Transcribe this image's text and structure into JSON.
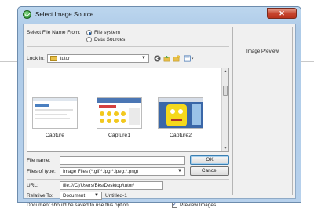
{
  "window": {
    "title": "Select Image Source",
    "close_glyph": "✕"
  },
  "select_from": {
    "label": "Select File Name From:",
    "options": [
      {
        "label": "File system",
        "selected": true
      },
      {
        "label": "Data Sources",
        "selected": false
      }
    ]
  },
  "look_in": {
    "label": "Look in:",
    "folder": "tutor",
    "toolbar_icons": [
      "back-arrow-icon",
      "up-folder-icon",
      "new-folder-icon",
      "view-menu-icon"
    ]
  },
  "files": [
    {
      "name": "Capture"
    },
    {
      "name": "Capture1"
    },
    {
      "name": "Capture2"
    }
  ],
  "file_name": {
    "label": "File name:",
    "value": ""
  },
  "files_of_type": {
    "label": "Files of type:",
    "value": "Image Files (*.gif;*.jpg;*.jpeg;*.png)"
  },
  "buttons": {
    "ok": "OK",
    "cancel": "Cancel"
  },
  "url": {
    "label": "URL:",
    "value": "file:///C|/Users/Bks/Desktop/tutor/"
  },
  "relative_to": {
    "label": "Relative To:",
    "value": "Document",
    "doc": "Untitled-1"
  },
  "notice": "Document should be saved to use this option.",
  "preview_images": {
    "label": "Preview Images",
    "checked": true
  },
  "preview_pane": {
    "label": "Image Preview"
  },
  "colors": {
    "title_bar": "#aecbe8",
    "close_button": "#c7462f",
    "accent": "#1a5aa0"
  }
}
